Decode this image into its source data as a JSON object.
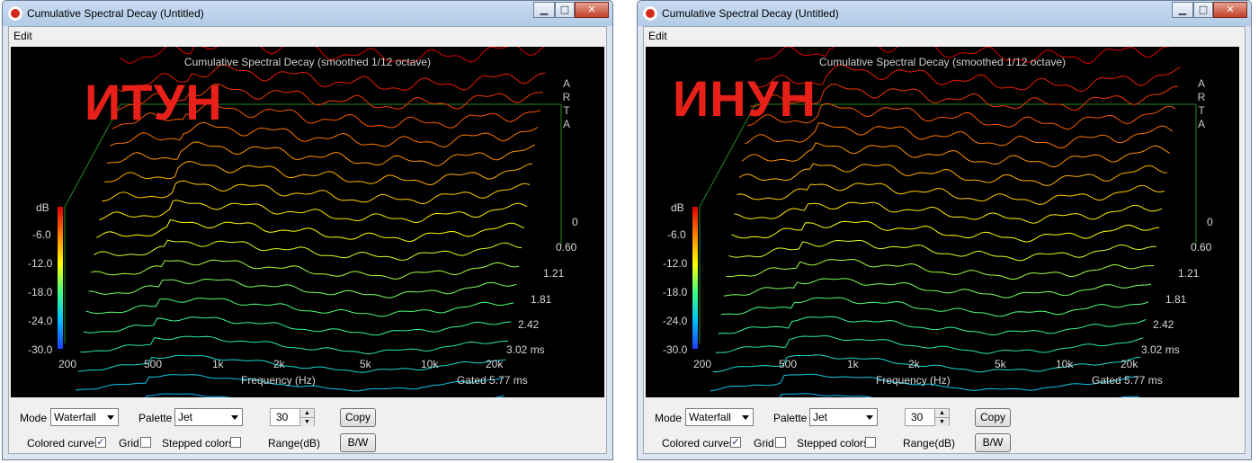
{
  "windows": [
    {
      "title": "Cumulative Spectral Decay  (Untitled)",
      "menu": [
        "Edit"
      ],
      "plot": {
        "title": "Cumulative Spectral Decay (smoothed 1/12 octave)",
        "overlay_label": "ИТУН",
        "watermark": [
          "A",
          "R",
          "T",
          "A"
        ],
        "db_unit": "dB",
        "db_ticks": [
          "-6.0",
          "-12.0",
          "-18.0",
          "-24.0",
          "-30.0"
        ],
        "freq_ticks": [
          "200",
          "500",
          "1k",
          "2k",
          "5k",
          "10k",
          "20k"
        ],
        "time_ticks": [
          "0",
          "0.60",
          "1.21",
          "1.81",
          "2.42",
          "3.02 ms"
        ],
        "xlabel": "Frequency (Hz)",
        "gated": "Gated 5.77 ms"
      },
      "controls": {
        "mode_label": "Mode",
        "mode_value": "Waterfall",
        "palette_label": "Palette",
        "palette_value": "Jet",
        "range_value": "30",
        "range_label": "Range(dB)",
        "copy_label": "Copy",
        "bw_label": "B/W",
        "colored_curves_label": "Colored curves",
        "colored_curves_checked": true,
        "grid_label": "Grid",
        "grid_checked": false,
        "stepped_label": "Stepped colors",
        "stepped_checked": false
      }
    },
    {
      "title": "Cumulative Spectral Decay  (Untitled)",
      "menu": [
        "Edit"
      ],
      "plot": {
        "title": "Cumulative Spectral Decay (smoothed 1/12 octave)",
        "overlay_label": "ИНУН",
        "watermark": [
          "A",
          "R",
          "T",
          "A"
        ],
        "db_unit": "dB",
        "db_ticks": [
          "-6.0",
          "-12.0",
          "-18.0",
          "-24.0",
          "-30.0"
        ],
        "freq_ticks": [
          "200",
          "500",
          "1k",
          "2k",
          "5k",
          "10k",
          "20k"
        ],
        "time_ticks": [
          "0",
          "0.60",
          "1.21",
          "1.81",
          "2.42",
          "3.02 ms"
        ],
        "xlabel": "Frequency (Hz)",
        "gated": "Gated 5.77 ms"
      },
      "controls": {
        "mode_label": "Mode",
        "mode_value": "Waterfall",
        "palette_label": "Palette",
        "palette_value": "Jet",
        "range_value": "30",
        "range_label": "Range(dB)",
        "copy_label": "Copy",
        "bw_label": "B/W",
        "colored_curves_label": "Colored curves",
        "colored_curves_checked": true,
        "grid_label": "Grid",
        "grid_checked": false,
        "stepped_label": "Stepped colors",
        "stepped_checked": false
      }
    }
  ],
  "colors": {
    "overlay_text": "#e8201a",
    "palette": [
      "#1f3cff",
      "#00c0ff",
      "#40ff80",
      "#ffff00",
      "#ff8000",
      "#e00000"
    ]
  }
}
